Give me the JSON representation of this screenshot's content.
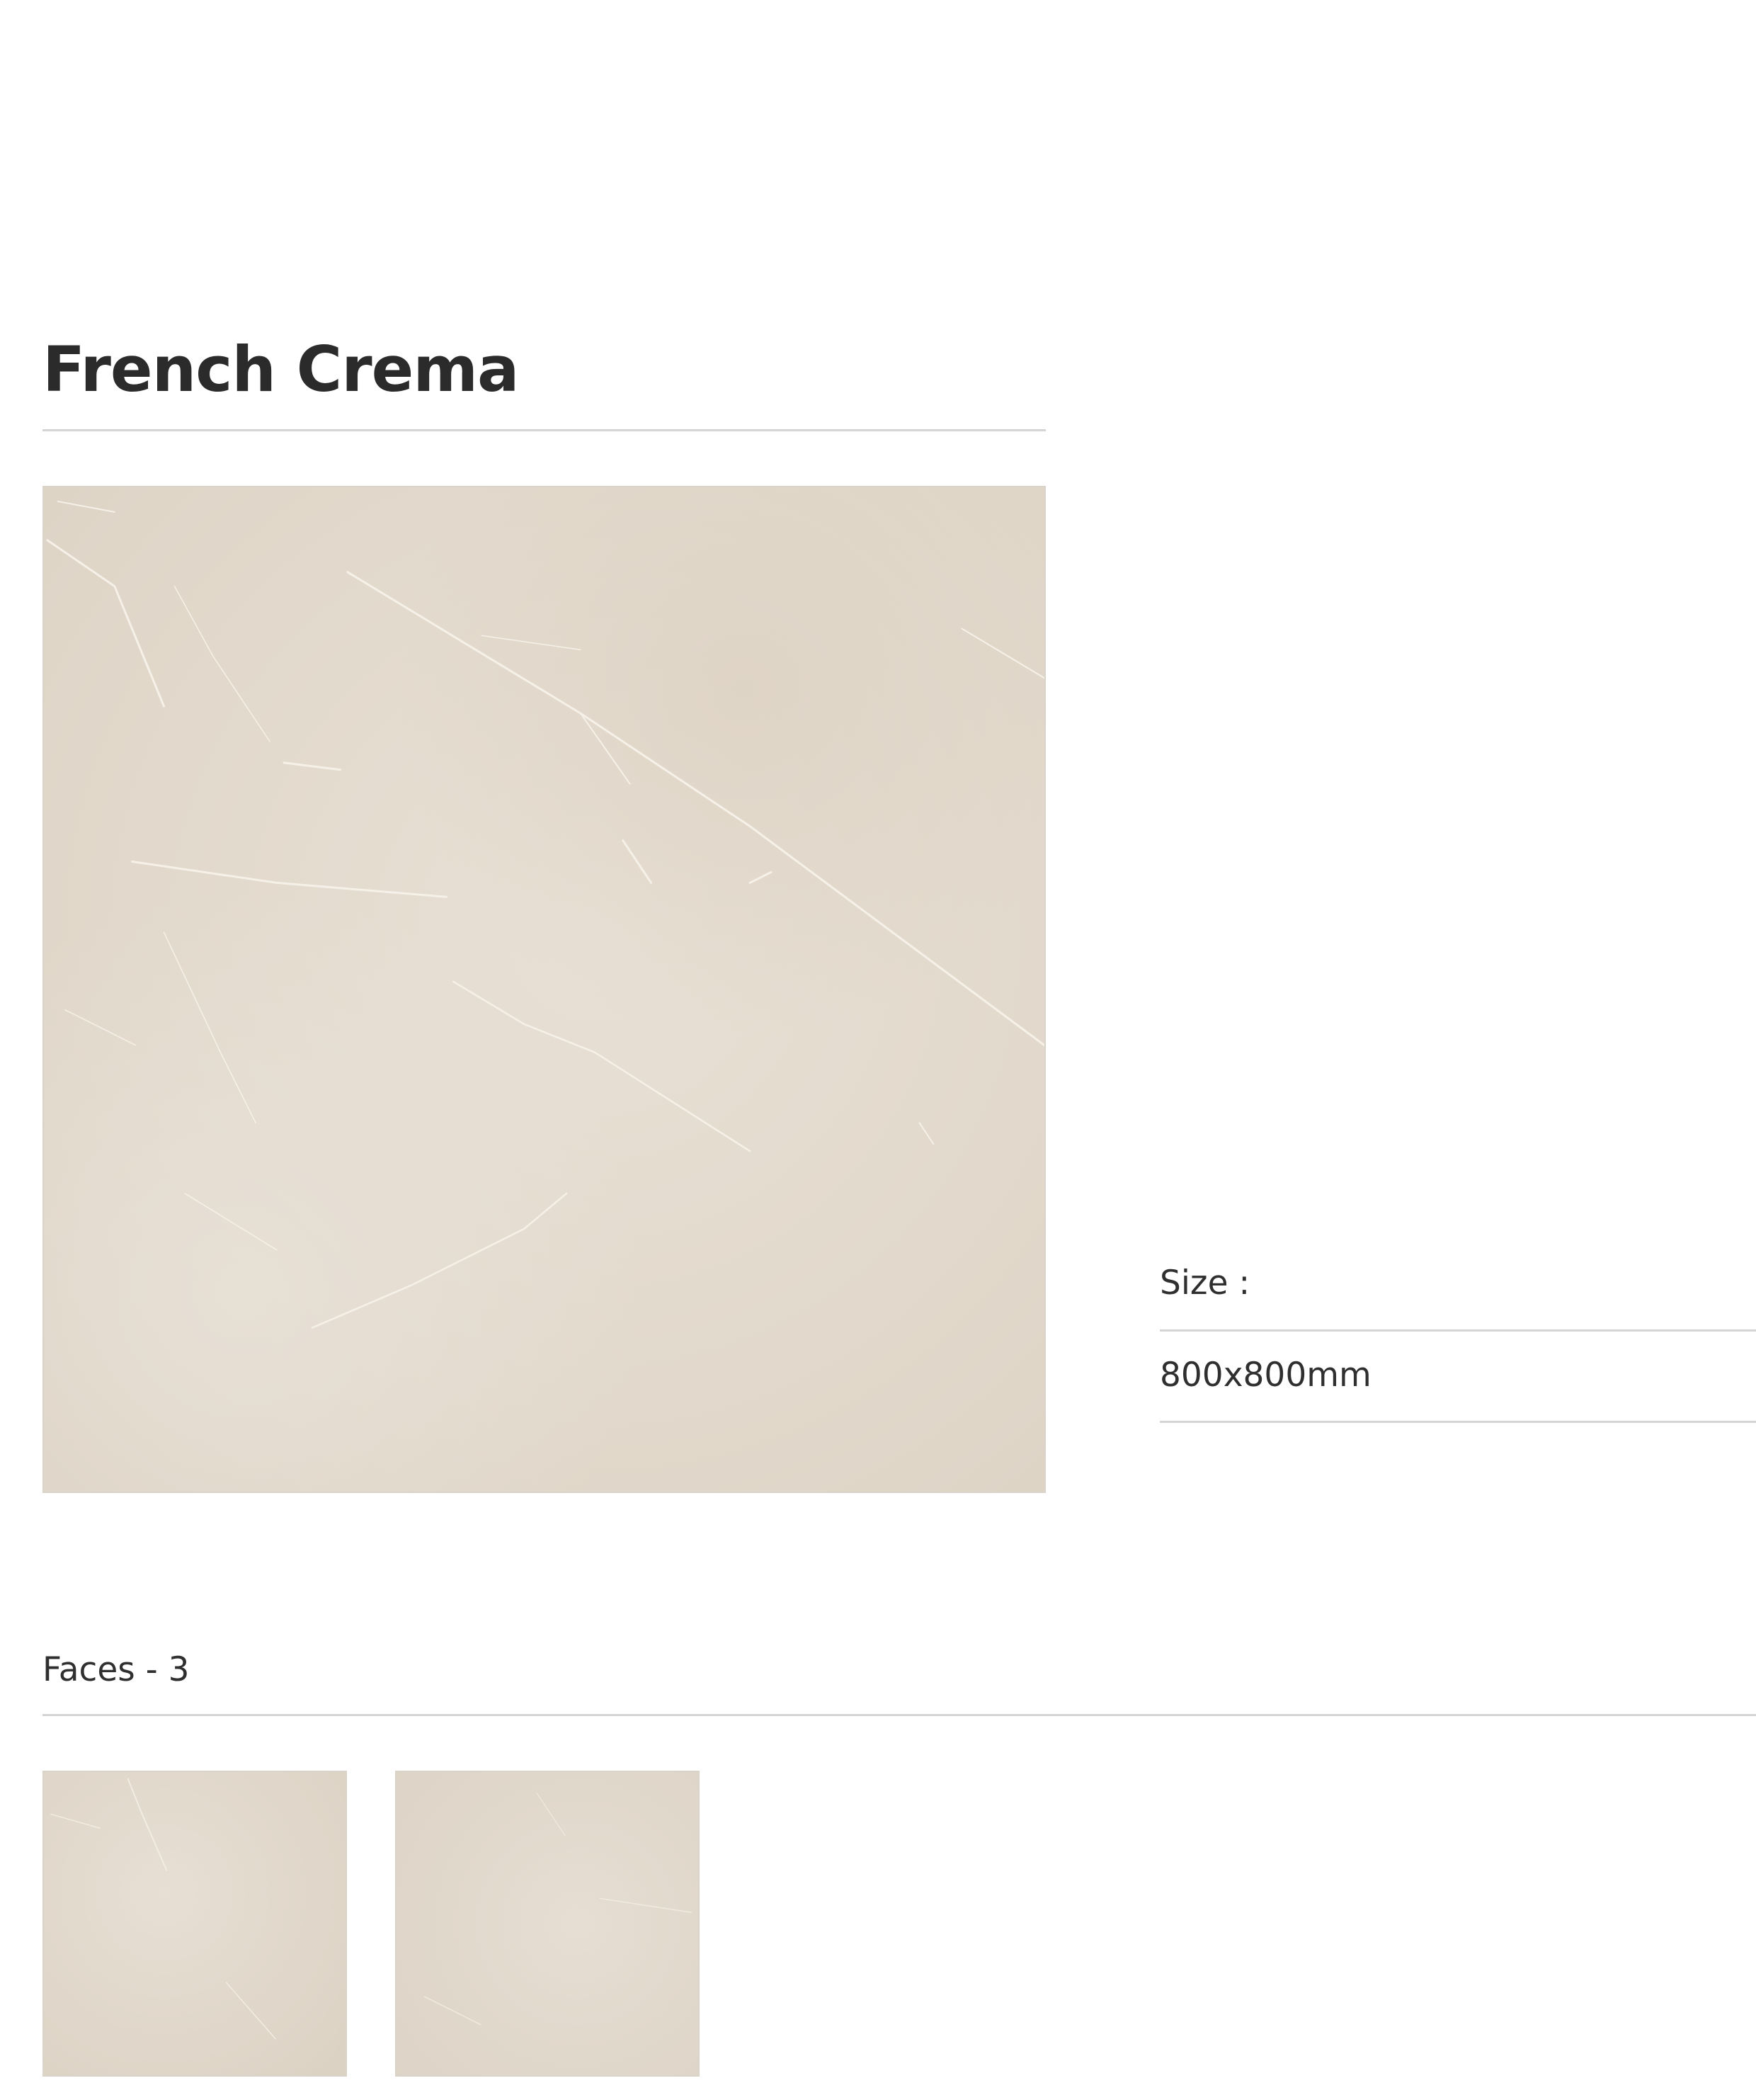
{
  "product": {
    "name": "French Crema"
  },
  "specs": {
    "size_label": "Size :",
    "size_value": "800x800mm"
  },
  "faces": {
    "label": "Faces - 3"
  },
  "colors": {
    "tile_base": "#e3dacd",
    "tile_vein": "#f6f1e8",
    "rule": "#d4d4d4",
    "text": "#2b2b2b"
  }
}
